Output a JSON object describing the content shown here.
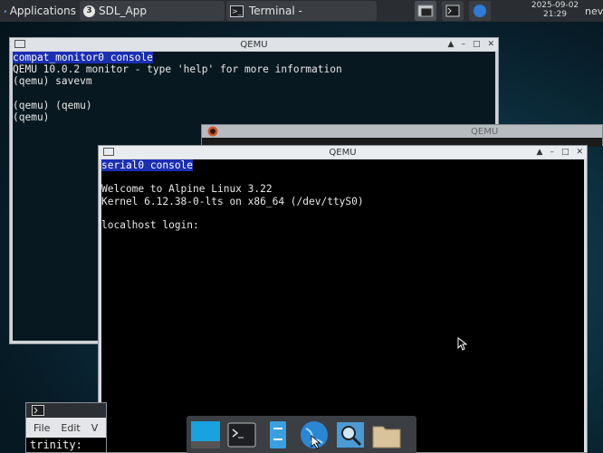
{
  "topbar": {
    "apps_label": "Applications",
    "task1": {
      "badge": "3",
      "label": "SDL_App"
    },
    "task2": {
      "label": "Terminal -"
    },
    "clock_date": "2025-09-02",
    "clock_time": "21:29",
    "user": "nev"
  },
  "monitor_window": {
    "title": "QEMU",
    "lines": [
      "compat_monitor0 console",
      "QEMU 10.0.2 monitor - type 'help' for more information",
      "(qemu) savevm",
      "",
      "(qemu) (qemu)",
      "(qemu)"
    ]
  },
  "back_window": {
    "title": "QEMU"
  },
  "serial_window": {
    "title": "QEMU",
    "lines": [
      "serial0 console",
      "",
      "Welcome to Alpine Linux 3.22",
      "Kernel 6.12.38-0-lts on x86_64 (/dev/ttyS0)",
      "",
      "localhost login:"
    ]
  },
  "trinity_window": {
    "menu": [
      "File",
      "Edit",
      "V"
    ],
    "prompt": "trinity:"
  },
  "dock": {
    "icons": [
      "show-desktop-icon",
      "terminal-icon",
      "file-manager-icon",
      "web-browser-icon",
      "app-finder-icon",
      "folder-icon"
    ]
  }
}
